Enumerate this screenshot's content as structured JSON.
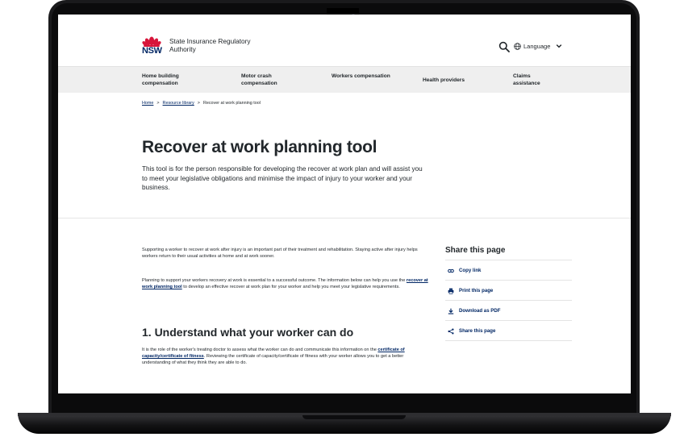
{
  "site": {
    "logo_text": "NSW",
    "agency_name": "State Insurance Regulatory Authority",
    "language_label": "Language"
  },
  "nav": {
    "items": [
      {
        "label": "Home building compensation"
      },
      {
        "label": "Motor crash compensation"
      },
      {
        "label": "Workers compensation"
      },
      {
        "label": "Health providers"
      },
      {
        "label": "Claims assistance"
      }
    ]
  },
  "breadcrumb": {
    "home": "Home",
    "sep": ">",
    "library": "Resource library",
    "current": "Recover at work planning tool"
  },
  "hero": {
    "title": "Recover at work planning tool",
    "intro": "This tool is for the person responsible for developing the recover at work plan and will assist you to meet your legislative obligations and minimise the impact of injury to your worker and your business."
  },
  "body": {
    "p1": "Supporting a worker to recover at work after injury is an important part of their treatment and rehabilitation. Staying active after injury helps workers return to their usual activities at home and at work sooner.",
    "p2_before": "Planning to support your workers recovery at work is essential to a successful outcome. The information below can help you use the ",
    "p2_link": "recover at work planning tool",
    "p2_after": " to develop an effective recover at work plan for your worker and help you meet your legislative requirements.",
    "section1_title": "1. Understand what your worker can do",
    "p3_before": "It is the role of the worker's treating doctor to assess what the worker can do and communicate this information on the ",
    "p3_link": "certificate of capacity/certificate of fitness",
    "p3_after": ". Reviewing the certificate of capacity/certificate of fitness with your worker allows you to get a better understanding of what they think they are able to do."
  },
  "share": {
    "title": "Share this page",
    "items": [
      {
        "label": "Copy link",
        "icon": "link-icon"
      },
      {
        "label": "Print this page",
        "icon": "printer-icon"
      },
      {
        "label": "Download as PDF",
        "icon": "download-icon"
      },
      {
        "label": "Share this page",
        "icon": "share-icon"
      }
    ]
  },
  "colors": {
    "brand_navy": "#002664",
    "brand_red": "#d7153a",
    "nav_bg": "#efefef"
  }
}
